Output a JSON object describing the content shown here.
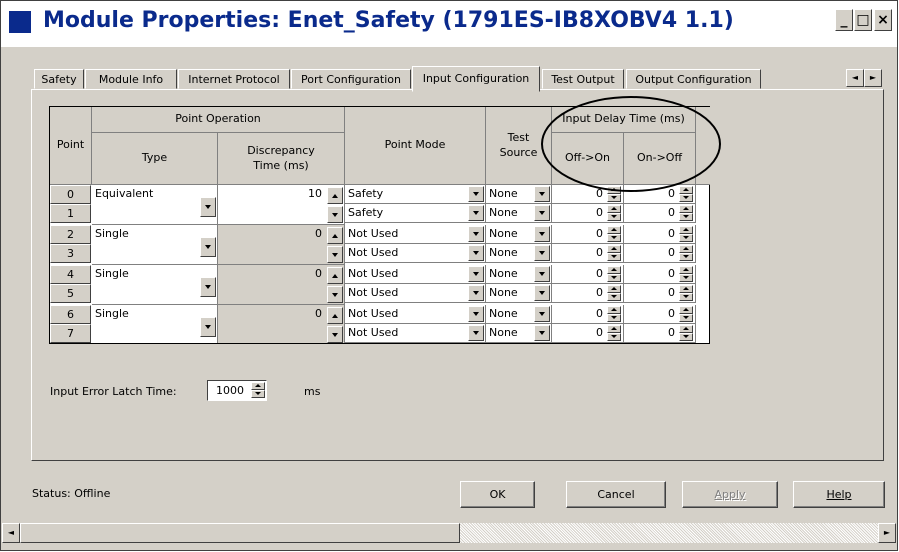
{
  "window": {
    "title": "Module Properties: Enet_Safety (1791ES-IB8XOBV4 1.1)",
    "min": "_",
    "max": "□",
    "close": "×"
  },
  "tabs": [
    "Safety",
    "Module Info",
    "Internet Protocol",
    "Port Configuration",
    "Input Configuration",
    "Test Output",
    "Output Configuration"
  ],
  "tab_scroll": {
    "left": "◄",
    "right": "►"
  },
  "table": {
    "headers": {
      "point": "Point",
      "point_operation": "Point Operation",
      "type": "Type",
      "discrepancy": "Discrepancy Time (ms)",
      "point_mode": "Point Mode",
      "test_source": "Test Source",
      "input_delay": "Input Delay Time (ms)",
      "off_on": "Off->On",
      "on_off": "On->Off"
    },
    "groups": [
      {
        "type": "Equivalent",
        "discrepancy": "10"
      },
      {
        "type": "Single",
        "discrepancy": "0"
      },
      {
        "type": "Single",
        "discrepancy": "0"
      },
      {
        "type": "Single",
        "discrepancy": "0"
      }
    ],
    "rows": [
      {
        "point": "0",
        "mode": "Safety",
        "test": "None",
        "off_on": "0",
        "on_off": "0"
      },
      {
        "point": "1",
        "mode": "Safety",
        "test": "None",
        "off_on": "0",
        "on_off": "0"
      },
      {
        "point": "2",
        "mode": "Not Used",
        "test": "None",
        "off_on": "0",
        "on_off": "0"
      },
      {
        "point": "3",
        "mode": "Not Used",
        "test": "None",
        "off_on": "0",
        "on_off": "0"
      },
      {
        "point": "4",
        "mode": "Not Used",
        "test": "None",
        "off_on": "0",
        "on_off": "0"
      },
      {
        "point": "5",
        "mode": "Not Used",
        "test": "None",
        "off_on": "0",
        "on_off": "0"
      },
      {
        "point": "6",
        "mode": "Not Used",
        "test": "None",
        "off_on": "0",
        "on_off": "0"
      },
      {
        "point": "7",
        "mode": "Not Used",
        "test": "None",
        "off_on": "0",
        "on_off": "0"
      }
    ]
  },
  "latch": {
    "label": "Input Error Latch Time:",
    "value": "1000",
    "unit": "ms"
  },
  "status": {
    "label": "Status:",
    "value": "Offline"
  },
  "buttons": {
    "ok": "OK",
    "cancel": "Cancel",
    "apply": "Apply",
    "help": "Help"
  },
  "scroll": {
    "left": "◄",
    "right": "►"
  },
  "colors": {
    "title_text": "#0a2a8c",
    "face": "#d4d0c8",
    "annotation": "#000000"
  }
}
